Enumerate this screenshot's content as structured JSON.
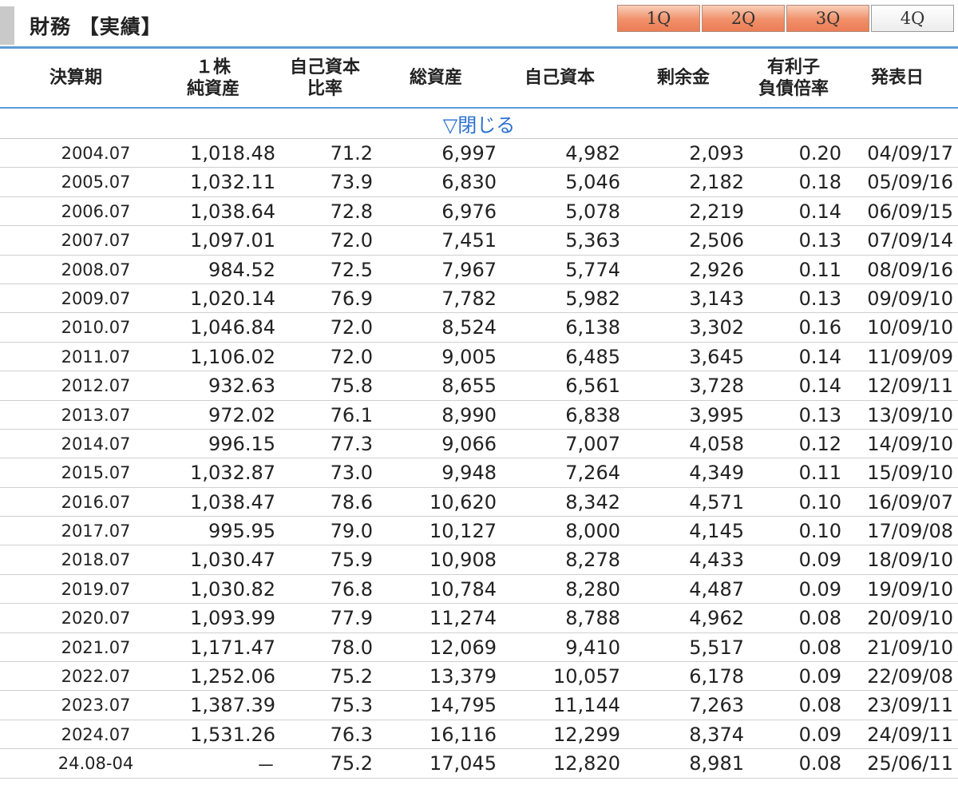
{
  "header": {
    "title": "財務 【実績】",
    "quarter_tabs": [
      "1Q",
      "2Q",
      "3Q",
      "4Q"
    ],
    "active_tab": "4Q"
  },
  "columns": [
    {
      "key": "period",
      "lines": [
        "決算期"
      ]
    },
    {
      "key": "bps",
      "lines": [
        "１株",
        "純資産"
      ]
    },
    {
      "key": "equity_ratio",
      "lines": [
        "自己資本",
        "比率"
      ]
    },
    {
      "key": "total_assets",
      "lines": [
        "総資産"
      ]
    },
    {
      "key": "equity",
      "lines": [
        "自己資本"
      ]
    },
    {
      "key": "retained",
      "lines": [
        "剰余金"
      ]
    },
    {
      "key": "debt_ratio",
      "lines": [
        "有利子",
        "負債倍率"
      ]
    },
    {
      "key": "date",
      "lines": [
        "発表日"
      ]
    }
  ],
  "collapse_label": "▽閉じる",
  "rows": [
    [
      "2004.07",
      "1,018.48",
      "71.2",
      "6,997",
      "4,982",
      "2,093",
      "0.20",
      "04/09/17"
    ],
    [
      "2005.07",
      "1,032.11",
      "73.9",
      "6,830",
      "5,046",
      "2,182",
      "0.18",
      "05/09/16"
    ],
    [
      "2006.07",
      "1,038.64",
      "72.8",
      "6,976",
      "5,078",
      "2,219",
      "0.14",
      "06/09/15"
    ],
    [
      "2007.07",
      "1,097.01",
      "72.0",
      "7,451",
      "5,363",
      "2,506",
      "0.13",
      "07/09/14"
    ],
    [
      "2008.07",
      "984.52",
      "72.5",
      "7,967",
      "5,774",
      "2,926",
      "0.11",
      "08/09/16"
    ],
    [
      "2009.07",
      "1,020.14",
      "76.9",
      "7,782",
      "5,982",
      "3,143",
      "0.13",
      "09/09/10"
    ],
    [
      "2010.07",
      "1,046.84",
      "72.0",
      "8,524",
      "6,138",
      "3,302",
      "0.16",
      "10/09/10"
    ],
    [
      "2011.07",
      "1,106.02",
      "72.0",
      "9,005",
      "6,485",
      "3,645",
      "0.14",
      "11/09/09"
    ],
    [
      "2012.07",
      "932.63",
      "75.8",
      "8,655",
      "6,561",
      "3,728",
      "0.14",
      "12/09/11"
    ],
    [
      "2013.07",
      "972.02",
      "76.1",
      "8,990",
      "6,838",
      "3,995",
      "0.13",
      "13/09/10"
    ],
    [
      "2014.07",
      "996.15",
      "77.3",
      "9,066",
      "7,007",
      "4,058",
      "0.12",
      "14/09/10"
    ],
    [
      "2015.07",
      "1,032.87",
      "73.0",
      "9,948",
      "7,264",
      "4,349",
      "0.11",
      "15/09/10"
    ],
    [
      "2016.07",
      "1,038.47",
      "78.6",
      "10,620",
      "8,342",
      "4,571",
      "0.10",
      "16/09/07"
    ],
    [
      "2017.07",
      "995.95",
      "79.0",
      "10,127",
      "8,000",
      "4,145",
      "0.10",
      "17/09/08"
    ],
    [
      "2018.07",
      "1,030.47",
      "75.9",
      "10,908",
      "8,278",
      "4,433",
      "0.09",
      "18/09/10"
    ],
    [
      "2019.07",
      "1,030.82",
      "76.8",
      "10,784",
      "8,280",
      "4,487",
      "0.09",
      "19/09/10"
    ],
    [
      "2020.07",
      "1,093.99",
      "77.9",
      "11,274",
      "8,788",
      "4,962",
      "0.08",
      "20/09/10"
    ],
    [
      "2021.07",
      "1,171.47",
      "78.0",
      "12,069",
      "9,410",
      "5,517",
      "0.08",
      "21/09/10"
    ],
    [
      "2022.07",
      "1,252.06",
      "75.2",
      "13,379",
      "10,057",
      "6,178",
      "0.09",
      "22/09/08"
    ],
    [
      "2023.07",
      "1,387.39",
      "75.3",
      "14,795",
      "11,144",
      "7,263",
      "0.08",
      "23/09/11"
    ],
    [
      "2024.07",
      "1,531.26",
      "76.3",
      "16,116",
      "12,299",
      "8,374",
      "0.09",
      "24/09/11"
    ],
    [
      "24.08-04",
      "－",
      "75.2",
      "17,045",
      "12,820",
      "8,981",
      "0.08",
      "25/06/11"
    ]
  ]
}
